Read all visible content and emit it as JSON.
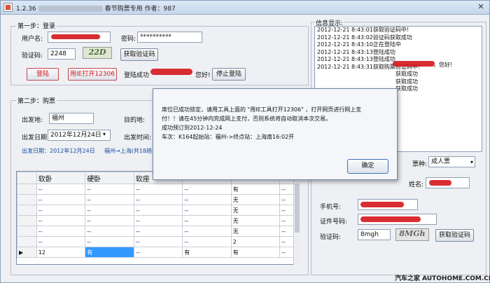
{
  "window": {
    "title_prefix": "1.2.36",
    "title_suffix": "春节购票专用  作者：987",
    "close": "✕"
  },
  "step1": {
    "title": "第一步：登录",
    "username_label": "用户名:",
    "password_label": "密码:",
    "password_value": "**********",
    "captcha_label": "验证码:",
    "captcha_value": "2248",
    "captcha_image_text": "22D",
    "get_captcha_button": "获取验证码",
    "login_button": "登陆",
    "ie_open_button": "用IE打开12306",
    "login_status_prefix": "登陆成功",
    "login_status_suffix": "您好!",
    "stop_login_button": "停止登陆"
  },
  "step2": {
    "title": "第二步：购票",
    "from_label": "出发地:",
    "from_value": "福州",
    "to_label": "目的地:",
    "date_label": "出发日期:",
    "date_value": "2012年12月24日",
    "time_label": "出发时间:",
    "date_info": "出发日期：2012年12月24日",
    "route_info": "福州→上海(共18趟"
  },
  "info": {
    "title": "信息显示:",
    "lines": [
      "2012-12-21 8:43:01获取验证码中!",
      "2012-12-21 8:43:02验证码获取成功",
      "2012-12-21 8:43:10正在登陆中",
      "2012-12-21 8:43:13登陆成功",
      "2012-12-21 8:43:13登陆成功",
      "2012-12-21 8:43:31获取购票验证码中!",
      "获取成功",
      "获取成功",
      "获取成功"
    ],
    "greeting": "，您好!"
  },
  "grid": {
    "headers": [
      "",
      "软卧",
      "硬卧",
      "软座",
      "",
      "",
      "",
      ""
    ],
    "rows": [
      [
        "",
        "--",
        "--",
        "--",
        "--",
        "有",
        "--"
      ],
      [
        "",
        "--",
        "--",
        "--",
        "--",
        "无",
        "--"
      ],
      [
        "",
        "--",
        "--",
        "--",
        "--",
        "无",
        "--"
      ],
      [
        "",
        "--",
        "--",
        "--",
        "--",
        "无",
        "--"
      ],
      [
        "",
        "--",
        "--",
        "--",
        "--",
        "无",
        "--"
      ],
      [
        "",
        "--",
        "--",
        "--",
        "--",
        "2",
        "--"
      ],
      [
        "▶",
        "12",
        "有",
        "--",
        "有",
        "有",
        "--"
      ]
    ]
  },
  "passenger": {
    "ticket_type_label": "票种:",
    "ticket_type_value": "成人票",
    "name_label": "姓名:",
    "phone_label": "手机号:",
    "id_label": "证件号码:",
    "captcha_label": "验证码:",
    "captcha_value": "8mgh",
    "captcha_image_text": "8MGh",
    "get_captcha_button": "获取验证码"
  },
  "dialog": {
    "line1": "席位已成功锁定，请用工具上面的 \"用IE工具打开12306\" ，打开网页进行网上支",
    "line2": "付！！请在45分钟内完成网上支付，否则系统将自动取消本次交易。",
    "line3": "成功预订到2012-12-24",
    "line4": "车次：K164起始站：福州->终点站：上海南16:02开",
    "ok_button": "确定"
  },
  "watermark": "汽车之家  AUTOHOME.COM.CN",
  "colors": {
    "redact": "#d4161b",
    "link": "#1b4fa0",
    "selection": "#3399ff"
  }
}
